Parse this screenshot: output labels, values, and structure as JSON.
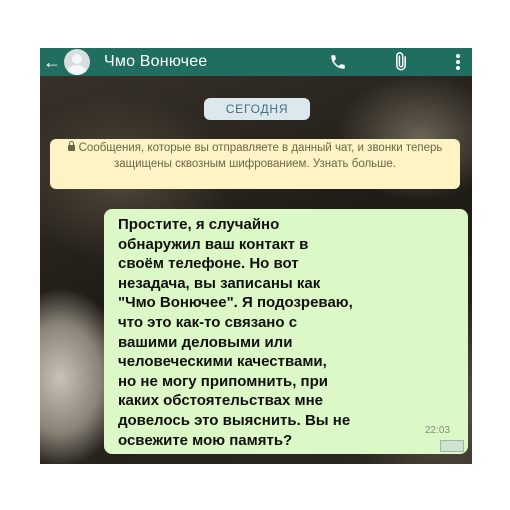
{
  "header": {
    "back_icon": "arrow-left-icon",
    "contact_name": "Чмо Вонючее",
    "call_icon": "phone-icon",
    "attach_icon": "paperclip-icon",
    "menu_icon": "more-vertical-icon",
    "color": "#1f6e5f"
  },
  "chat": {
    "date_label": "СЕГОДНЯ",
    "encryption_notice": "Сообщения, которые вы отправляете в данный чат, и звонки теперь защищены сквозным шифрованием. Узнать больше.",
    "messages": [
      {
        "text": "Простите, я случайно\nобнаружил ваш контакт в\nсвоём телефоне. Но вот\nнезадача, вы записаны как\n\"Чмо Вонючее\". Я подозреваю,\nчто это как-то связано с\nвашими деловыми или\nчеловеческими качествами,\nно не могу припомнить, при\nкаких обстоятельствах мне\nдовелось это выяснить. Вы не\nосвежите мою память?",
        "time": "22:03",
        "bubble_color": "#dcf8c6"
      }
    ]
  }
}
